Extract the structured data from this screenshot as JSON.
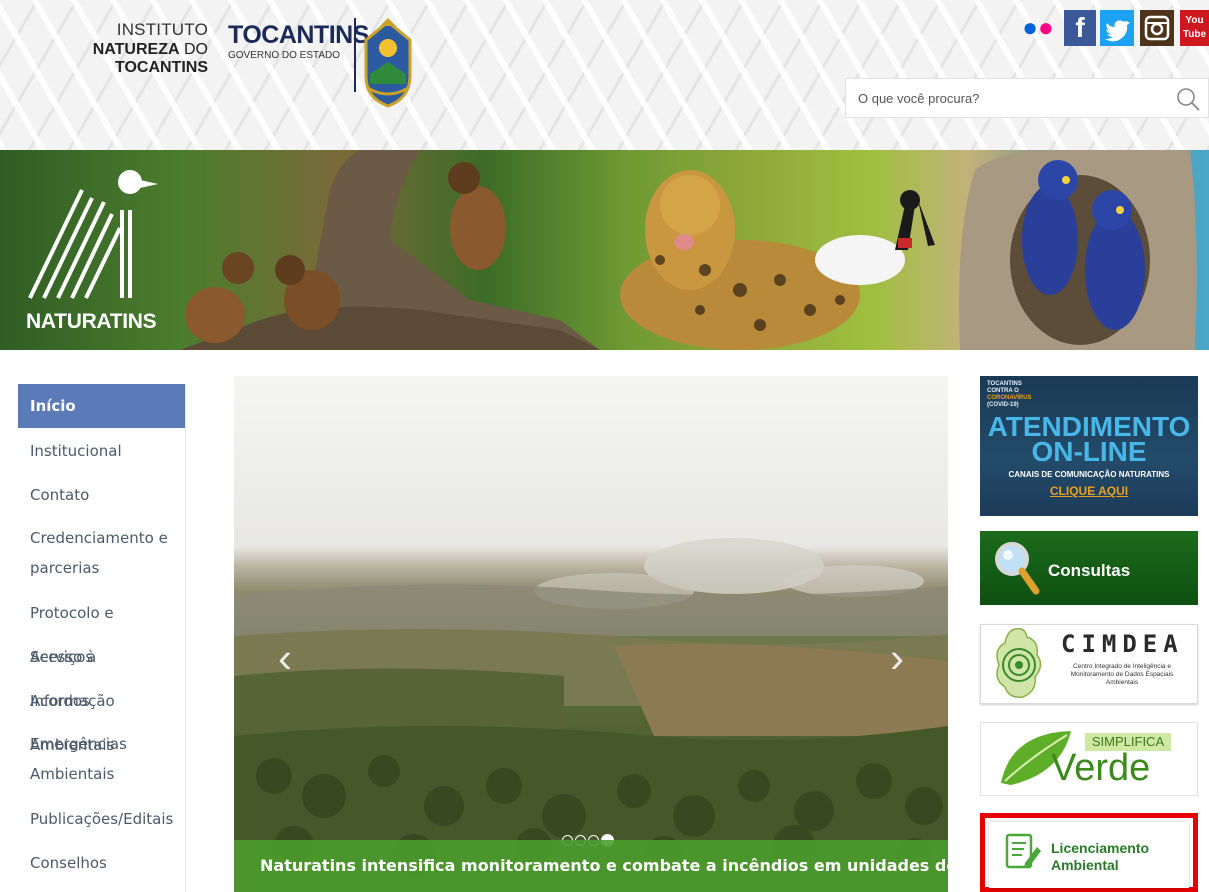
{
  "header": {
    "institute_line1": "INSTITUTO",
    "institute_line2_bold": "NATUREZA",
    "institute_line2_mid": "DO",
    "institute_line2_bold2": "TOCANTINS",
    "state_name": "TOCANTINS",
    "state_sub": "GOVERNO DO ESTADO",
    "crest_icon": "state-crest-icon",
    "social": [
      {
        "name": "flickr",
        "icon": "flickr-icon",
        "colors": [
          "#0063dc",
          "#ff0084"
        ]
      },
      {
        "name": "facebook",
        "icon": "facebook-icon",
        "glyph": "f",
        "color": "#3b5998"
      },
      {
        "name": "twitter",
        "icon": "twitter-icon",
        "color": "#1da1f2"
      },
      {
        "name": "instagram",
        "icon": "instagram-icon",
        "color": "#4d3319"
      },
      {
        "name": "youtube",
        "icon": "youtube-icon",
        "line1": "You",
        "line2": "Tube",
        "color": "#cc181e"
      }
    ],
    "search": {
      "placeholder": "O que você procura?",
      "icon": "search-icon"
    }
  },
  "banner": {
    "brand": "NATURATINS",
    "logo_icon": "naturatins-logo-icon"
  },
  "menu": {
    "items": [
      {
        "label": "Início",
        "active": true
      },
      {
        "label": "Institucional"
      },
      {
        "label": "Contato"
      },
      {
        "label": "Credenciamento e parcerias"
      },
      {
        "label": "Protocolo e Serviços"
      },
      {
        "label": "Acesso à Informação"
      },
      {
        "label": "Acordos Ambientais"
      },
      {
        "label": "Emergências Ambientais"
      },
      {
        "label": "Publicações/Editais"
      },
      {
        "label": "Conselhos"
      }
    ]
  },
  "carousel": {
    "caption": "Naturatins intensifica monitoramento e combate a incêndios em unidades de conservação",
    "prev_glyph": "‹",
    "next_glyph": "›",
    "slide_count": 4,
    "active_slide": 4
  },
  "right_banners": {
    "atendimento": {
      "small_line1": "TOCANTINS",
      "small_line2": "CONTRA O",
      "small_line3": "CORONAVÍRUS",
      "small_line4": "(COVID-19)",
      "title_line1": "ATENDIMENTO",
      "title_line2": "ON-LINE",
      "subtitle": "CANAIS DE COMUNICAÇÃO NATURATINS",
      "cta": "CLIQUE AQUI",
      "colors": {
        "title": "#49b6e8",
        "cta": "#e8a020",
        "bg": "#1a3a55"
      }
    },
    "consultas": {
      "label": "Consultas",
      "icon": "magnifier-icon"
    },
    "cimdea": {
      "title": "CIMDEA",
      "subtitle": "Centro Integrado de Inteligência e Monitoramento de Dados Espaciais Ambientais",
      "icon": "tocantins-map-icon"
    },
    "simplifica": {
      "top": "SIMPLIFICA",
      "bottom": "Verde",
      "icon": "leaf-icon"
    },
    "licenciamento": {
      "line1": "Licenciamento",
      "line2": "Ambiental",
      "icon": "document-edit-icon",
      "highlight_color": "#e60000"
    }
  }
}
